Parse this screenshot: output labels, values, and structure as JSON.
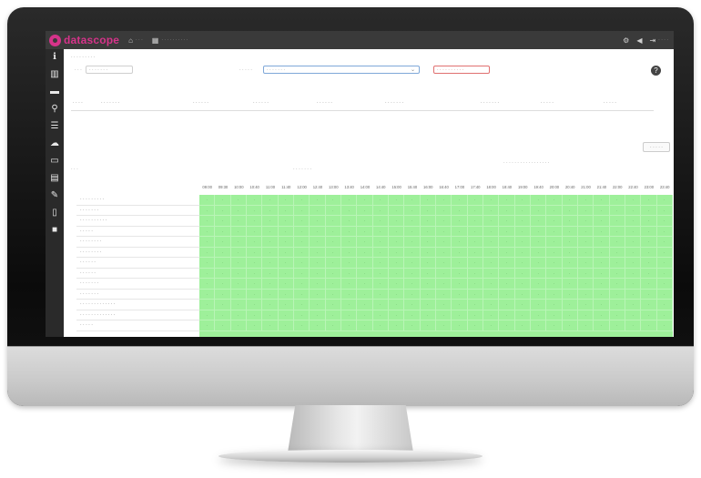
{
  "app": {
    "logo_text": "datascope",
    "brand_color": "#d6338a",
    "nav": [
      {
        "icon": "home-icon",
        "label": "· · ·"
      },
      {
        "icon": "calendar-icon",
        "label": "· · · · · · · · · ·"
      }
    ],
    "right": {
      "user": "· · · ·"
    }
  },
  "sidebar": {
    "items": [
      {
        "icon": "info-icon",
        "glyph": "ℹ"
      },
      {
        "icon": "chart-icon",
        "glyph": "▥"
      },
      {
        "icon": "folder-icon",
        "glyph": "▬"
      },
      {
        "icon": "search-icon",
        "glyph": "⚲"
      },
      {
        "icon": "list-icon",
        "glyph": "☰"
      },
      {
        "icon": "cloud-icon",
        "glyph": "☁"
      },
      {
        "icon": "monitor-icon",
        "glyph": "▭"
      },
      {
        "icon": "document-icon",
        "glyph": "▤"
      },
      {
        "icon": "edit-icon",
        "glyph": "✎"
      },
      {
        "icon": "file-icon",
        "glyph": "▯"
      },
      {
        "icon": "video-icon",
        "glyph": "■"
      }
    ]
  },
  "page": {
    "breadcrumb": "· · · · · · · · ·",
    "date_label": "· · ·",
    "date_value": "· · · · · · ·",
    "select_label": "· · · · ·",
    "select_value": "· · · · · · ·",
    "apply_label": "· · · · · · · · · ·",
    "column_filters": [
      "· · · ·",
      "· · · · · · ·",
      "· · · · · ·",
      "· · · · · ·",
      "· · · · · ·",
      "· · · · · · ·",
      "· · · · · · ·",
      "· · · · ·",
      "· · · · ·"
    ],
    "clear_label": "· · · · ·",
    "info_left": "· · ·",
    "info_mid": "· · · · · · ·",
    "info_right": "· · · · · · · · · · · · · · · · ·",
    "help_icon": "?"
  },
  "grid": {
    "times": [
      "09:00",
      "09:30",
      "10:00",
      "10:40",
      "11:00",
      "11:40",
      "12:00",
      "12:40",
      "13:00",
      "13:40",
      "14:00",
      "14:40",
      "15:00",
      "15:40",
      "16:00",
      "16:40",
      "17:00",
      "17:40",
      "18:00",
      "18:40",
      "19:00",
      "19:40",
      "20:00",
      "20:40",
      "21:00",
      "21:40",
      "22:00",
      "22:40",
      "23:00",
      "23:40"
    ],
    "rooms": [
      "· · · · · · · · ·",
      "· · · · · · ·",
      "· · · · · · · · · ·",
      "· · · · ·",
      "· · · · · · · ·",
      "· · · · · · · ·",
      "· · · · · ·",
      "· · · · · ·",
      "· · · · · · ·",
      "· · · · · · ·",
      "· · · · · · · · · · · · ·",
      "· · · · · · · · · · · · ·",
      "· · · · ·"
    ],
    "cell_mark": "·",
    "available_color": "#9ef09a"
  }
}
